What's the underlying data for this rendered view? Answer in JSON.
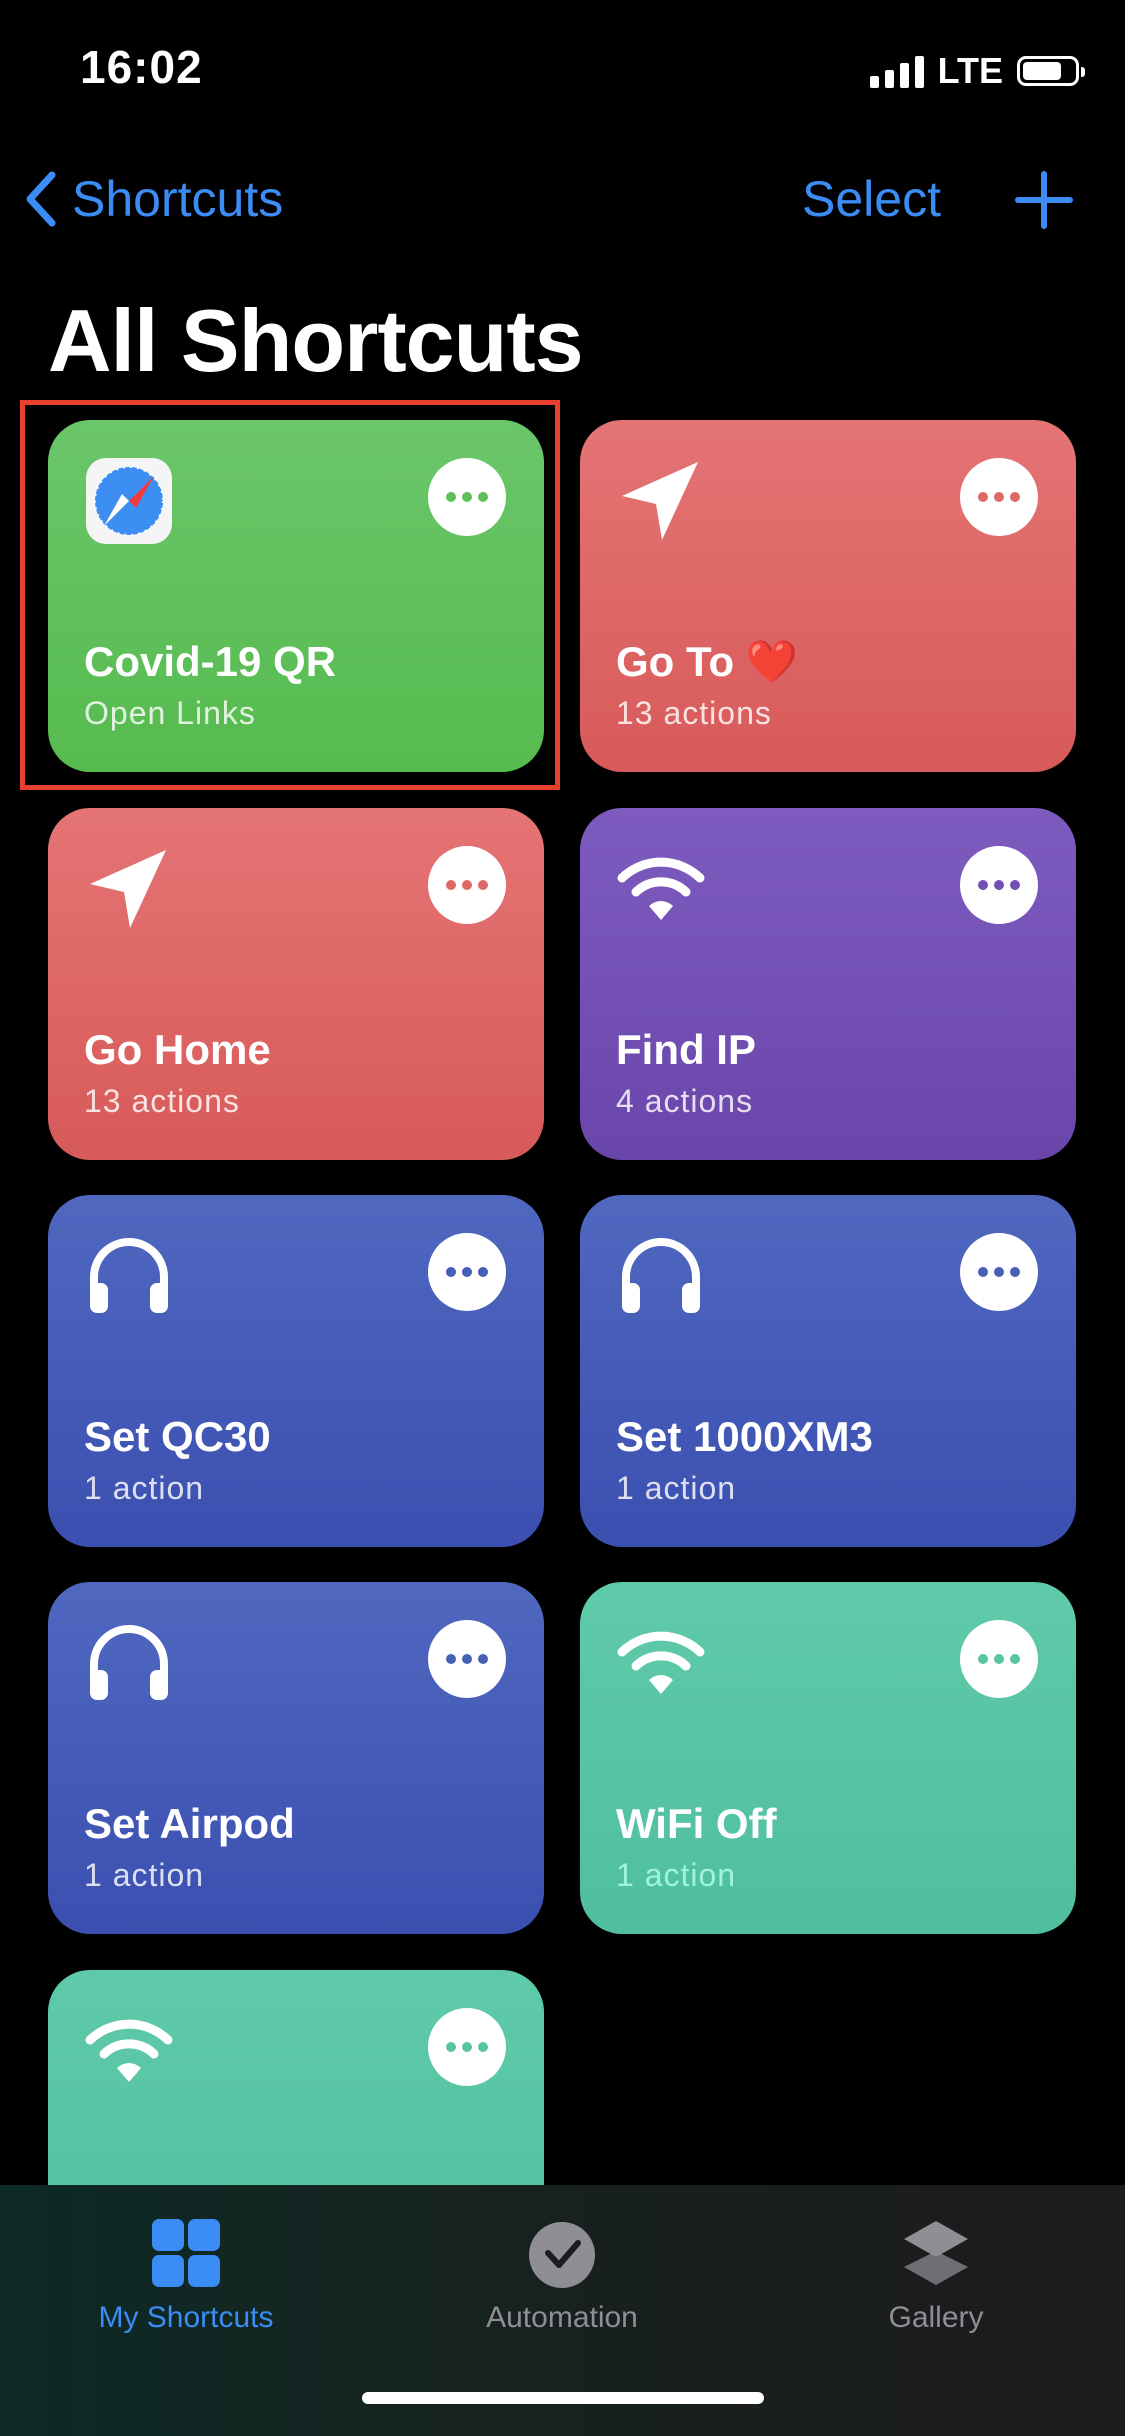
{
  "status_bar": {
    "time": "16:02",
    "network": "LTE"
  },
  "nav": {
    "back_label": "Shortcuts",
    "select_label": "Select",
    "add_icon": "plus-icon"
  },
  "page_title": "All Shortcuts",
  "shortcuts": [
    {
      "title": "Covid-19 QR",
      "subtitle": "Open Links",
      "icon": "safari-icon",
      "color": "#5fbf5b"
    },
    {
      "title": "Go To ❤️",
      "subtitle": "13 actions",
      "icon": "location-arrow-icon",
      "color": "#df6868"
    },
    {
      "title": "Go Home",
      "subtitle": "13 actions",
      "icon": "location-arrow-icon",
      "color": "#df6868"
    },
    {
      "title": "Find IP",
      "subtitle": "4 actions",
      "icon": "wifi-icon",
      "color": "#7450b4"
    },
    {
      "title": "Set QC30",
      "subtitle": "1 action",
      "icon": "headphones-icon",
      "color": "#4660b8"
    },
    {
      "title": "Set 1000XM3",
      "subtitle": "1 action",
      "icon": "headphones-icon",
      "color": "#4660b8"
    },
    {
      "title": "Set Airpod",
      "subtitle": "1 action",
      "icon": "headphones-icon",
      "color": "#4660b8"
    },
    {
      "title": "WiFi Off",
      "subtitle": "1 action",
      "icon": "wifi-icon",
      "color": "#58c5a5"
    },
    {
      "title": "",
      "subtitle": "",
      "icon": "wifi-icon",
      "color": "#58c5a5"
    }
  ],
  "tab_bar": {
    "tabs": [
      {
        "label": "My Shortcuts",
        "icon": "grid-icon",
        "active": true
      },
      {
        "label": "Automation",
        "icon": "clock-check-icon",
        "active": false
      },
      {
        "label": "Gallery",
        "icon": "layers-icon",
        "active": false
      }
    ]
  },
  "colors": {
    "accent": "#3b8cf5",
    "highlight": "#e8402c"
  }
}
